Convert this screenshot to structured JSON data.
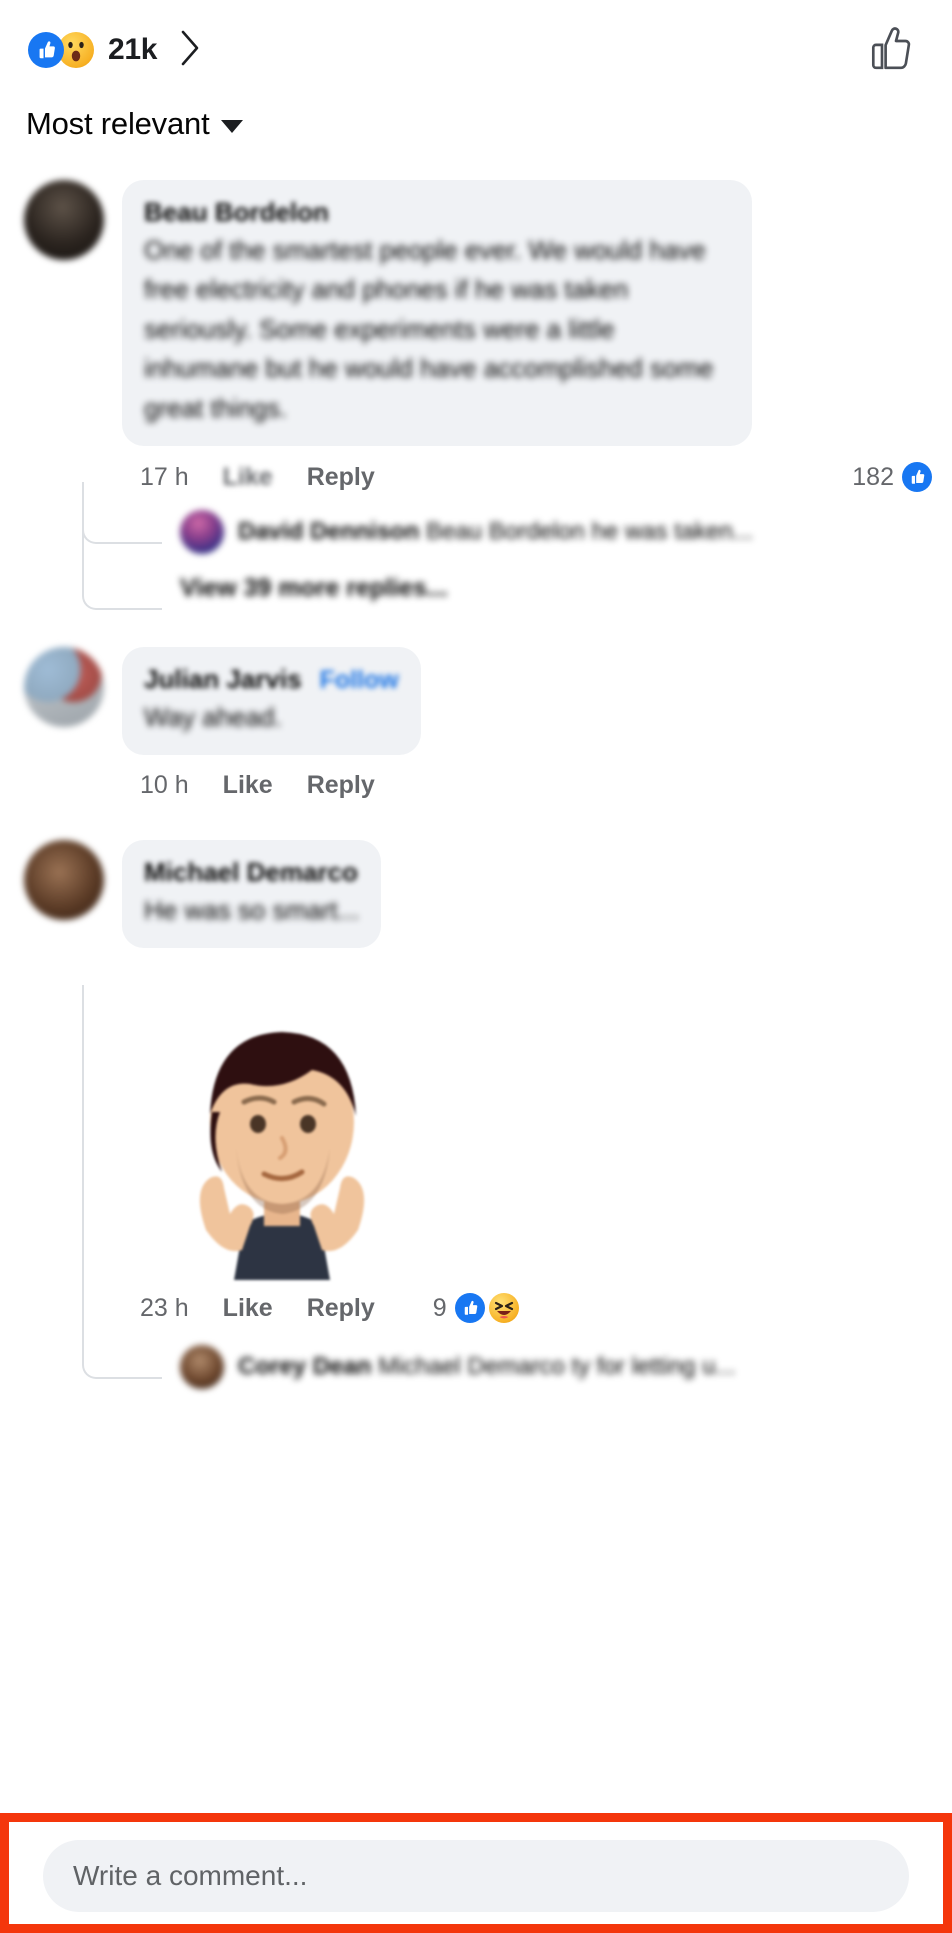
{
  "header": {
    "reactions": {
      "icons": [
        "like-reaction-icon",
        "wow-reaction-icon"
      ],
      "count": "21k",
      "chevron": "chevron-right-icon"
    },
    "like_button_icon": "thumbs-up-outline-icon"
  },
  "sort": {
    "label": "Most relevant",
    "caret": "chevron-down-icon"
  },
  "comments": [
    {
      "author": "Beau Bordelon",
      "text": "One of the smartest people ever. We would have free electricity and phones if he was taken seriously. Some experiments were a little inhumane but he would have accomplished some great things.",
      "time": "17 h",
      "like_label": "Like",
      "reply_label": "Reply",
      "reaction_count": "182",
      "reaction_icons": [
        "like-reaction-icon"
      ],
      "replies": [
        {
          "author": "David Dennison",
          "text": "Beau Bordelon he was taken..."
        }
      ],
      "view_more": "View 39 more replies..."
    },
    {
      "author": "Julian Jarvis",
      "follow_label": "Follow",
      "text": "Way ahead.",
      "time": "10 h",
      "like_label": "Like",
      "reply_label": "Reply"
    },
    {
      "author": "Michael Demarco",
      "text": "He was so smart...",
      "sticker": "shrug-avatar-sticker",
      "time": "23 h",
      "like_label": "Like",
      "reply_label": "Reply",
      "reaction_count": "9",
      "reaction_icons": [
        "like-reaction-icon",
        "haha-reaction-icon"
      ],
      "replies": [
        {
          "author": "Corey Dean",
          "text": "Michael Demarco ty for letting u..."
        }
      ]
    }
  ],
  "composer": {
    "placeholder": "Write a comment...",
    "highlight_color": "#f4360c"
  }
}
